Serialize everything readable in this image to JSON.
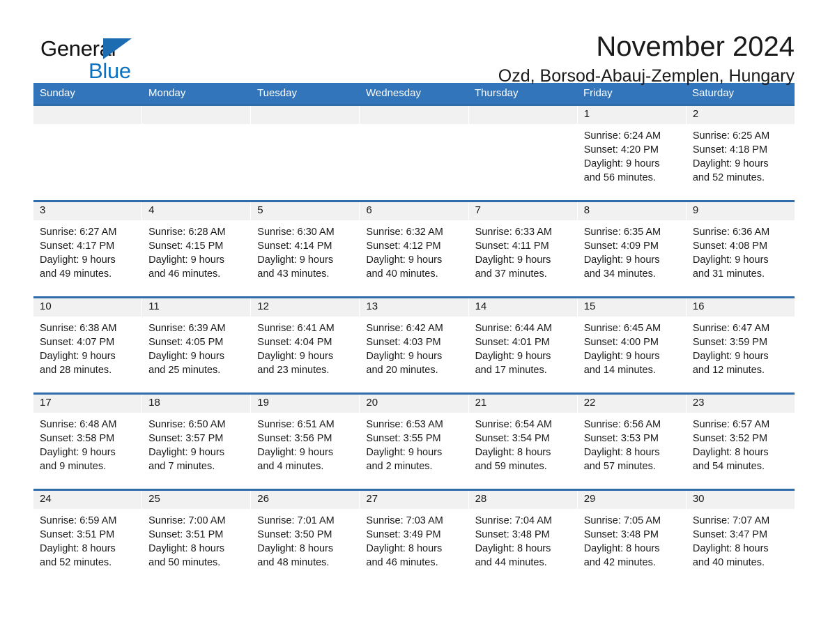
{
  "brand": {
    "name_part1": "General",
    "name_part2": "Blue",
    "triangle_color": "#1b6cb0",
    "blue_color": "#0c72c0"
  },
  "header": {
    "title": "November 2024",
    "subtitle": "Ozd, Borsod-Abauj-Zemplen, Hungary"
  },
  "theme": {
    "header_blue": "#3275ba",
    "row_border_blue": "#2e6da9",
    "daynum_strip": "#f1f1f1"
  },
  "weekdays": [
    "Sunday",
    "Monday",
    "Tuesday",
    "Wednesday",
    "Thursday",
    "Friday",
    "Saturday"
  ],
  "weeks": [
    [
      {
        "day": "",
        "lines": []
      },
      {
        "day": "",
        "lines": []
      },
      {
        "day": "",
        "lines": []
      },
      {
        "day": "",
        "lines": []
      },
      {
        "day": "",
        "lines": []
      },
      {
        "day": "1",
        "lines": [
          "Sunrise: 6:24 AM",
          "Sunset: 4:20 PM",
          "Daylight: 9 hours",
          "and 56 minutes."
        ]
      },
      {
        "day": "2",
        "lines": [
          "Sunrise: 6:25 AM",
          "Sunset: 4:18 PM",
          "Daylight: 9 hours",
          "and 52 minutes."
        ]
      }
    ],
    [
      {
        "day": "3",
        "lines": [
          "Sunrise: 6:27 AM",
          "Sunset: 4:17 PM",
          "Daylight: 9 hours",
          "and 49 minutes."
        ]
      },
      {
        "day": "4",
        "lines": [
          "Sunrise: 6:28 AM",
          "Sunset: 4:15 PM",
          "Daylight: 9 hours",
          "and 46 minutes."
        ]
      },
      {
        "day": "5",
        "lines": [
          "Sunrise: 6:30 AM",
          "Sunset: 4:14 PM",
          "Daylight: 9 hours",
          "and 43 minutes."
        ]
      },
      {
        "day": "6",
        "lines": [
          "Sunrise: 6:32 AM",
          "Sunset: 4:12 PM",
          "Daylight: 9 hours",
          "and 40 minutes."
        ]
      },
      {
        "day": "7",
        "lines": [
          "Sunrise: 6:33 AM",
          "Sunset: 4:11 PM",
          "Daylight: 9 hours",
          "and 37 minutes."
        ]
      },
      {
        "day": "8",
        "lines": [
          "Sunrise: 6:35 AM",
          "Sunset: 4:09 PM",
          "Daylight: 9 hours",
          "and 34 minutes."
        ]
      },
      {
        "day": "9",
        "lines": [
          "Sunrise: 6:36 AM",
          "Sunset: 4:08 PM",
          "Daylight: 9 hours",
          "and 31 minutes."
        ]
      }
    ],
    [
      {
        "day": "10",
        "lines": [
          "Sunrise: 6:38 AM",
          "Sunset: 4:07 PM",
          "Daylight: 9 hours",
          "and 28 minutes."
        ]
      },
      {
        "day": "11",
        "lines": [
          "Sunrise: 6:39 AM",
          "Sunset: 4:05 PM",
          "Daylight: 9 hours",
          "and 25 minutes."
        ]
      },
      {
        "day": "12",
        "lines": [
          "Sunrise: 6:41 AM",
          "Sunset: 4:04 PM",
          "Daylight: 9 hours",
          "and 23 minutes."
        ]
      },
      {
        "day": "13",
        "lines": [
          "Sunrise: 6:42 AM",
          "Sunset: 4:03 PM",
          "Daylight: 9 hours",
          "and 20 minutes."
        ]
      },
      {
        "day": "14",
        "lines": [
          "Sunrise: 6:44 AM",
          "Sunset: 4:01 PM",
          "Daylight: 9 hours",
          "and 17 minutes."
        ]
      },
      {
        "day": "15",
        "lines": [
          "Sunrise: 6:45 AM",
          "Sunset: 4:00 PM",
          "Daylight: 9 hours",
          "and 14 minutes."
        ]
      },
      {
        "day": "16",
        "lines": [
          "Sunrise: 6:47 AM",
          "Sunset: 3:59 PM",
          "Daylight: 9 hours",
          "and 12 minutes."
        ]
      }
    ],
    [
      {
        "day": "17",
        "lines": [
          "Sunrise: 6:48 AM",
          "Sunset: 3:58 PM",
          "Daylight: 9 hours",
          "and 9 minutes."
        ]
      },
      {
        "day": "18",
        "lines": [
          "Sunrise: 6:50 AM",
          "Sunset: 3:57 PM",
          "Daylight: 9 hours",
          "and 7 minutes."
        ]
      },
      {
        "day": "19",
        "lines": [
          "Sunrise: 6:51 AM",
          "Sunset: 3:56 PM",
          "Daylight: 9 hours",
          "and 4 minutes."
        ]
      },
      {
        "day": "20",
        "lines": [
          "Sunrise: 6:53 AM",
          "Sunset: 3:55 PM",
          "Daylight: 9 hours",
          "and 2 minutes."
        ]
      },
      {
        "day": "21",
        "lines": [
          "Sunrise: 6:54 AM",
          "Sunset: 3:54 PM",
          "Daylight: 8 hours",
          "and 59 minutes."
        ]
      },
      {
        "day": "22",
        "lines": [
          "Sunrise: 6:56 AM",
          "Sunset: 3:53 PM",
          "Daylight: 8 hours",
          "and 57 minutes."
        ]
      },
      {
        "day": "23",
        "lines": [
          "Sunrise: 6:57 AM",
          "Sunset: 3:52 PM",
          "Daylight: 8 hours",
          "and 54 minutes."
        ]
      }
    ],
    [
      {
        "day": "24",
        "lines": [
          "Sunrise: 6:59 AM",
          "Sunset: 3:51 PM",
          "Daylight: 8 hours",
          "and 52 minutes."
        ]
      },
      {
        "day": "25",
        "lines": [
          "Sunrise: 7:00 AM",
          "Sunset: 3:51 PM",
          "Daylight: 8 hours",
          "and 50 minutes."
        ]
      },
      {
        "day": "26",
        "lines": [
          "Sunrise: 7:01 AM",
          "Sunset: 3:50 PM",
          "Daylight: 8 hours",
          "and 48 minutes."
        ]
      },
      {
        "day": "27",
        "lines": [
          "Sunrise: 7:03 AM",
          "Sunset: 3:49 PM",
          "Daylight: 8 hours",
          "and 46 minutes."
        ]
      },
      {
        "day": "28",
        "lines": [
          "Sunrise: 7:04 AM",
          "Sunset: 3:48 PM",
          "Daylight: 8 hours",
          "and 44 minutes."
        ]
      },
      {
        "day": "29",
        "lines": [
          "Sunrise: 7:05 AM",
          "Sunset: 3:48 PM",
          "Daylight: 8 hours",
          "and 42 minutes."
        ]
      },
      {
        "day": "30",
        "lines": [
          "Sunrise: 7:07 AM",
          "Sunset: 3:47 PM",
          "Daylight: 8 hours",
          "and 40 minutes."
        ]
      }
    ]
  ]
}
